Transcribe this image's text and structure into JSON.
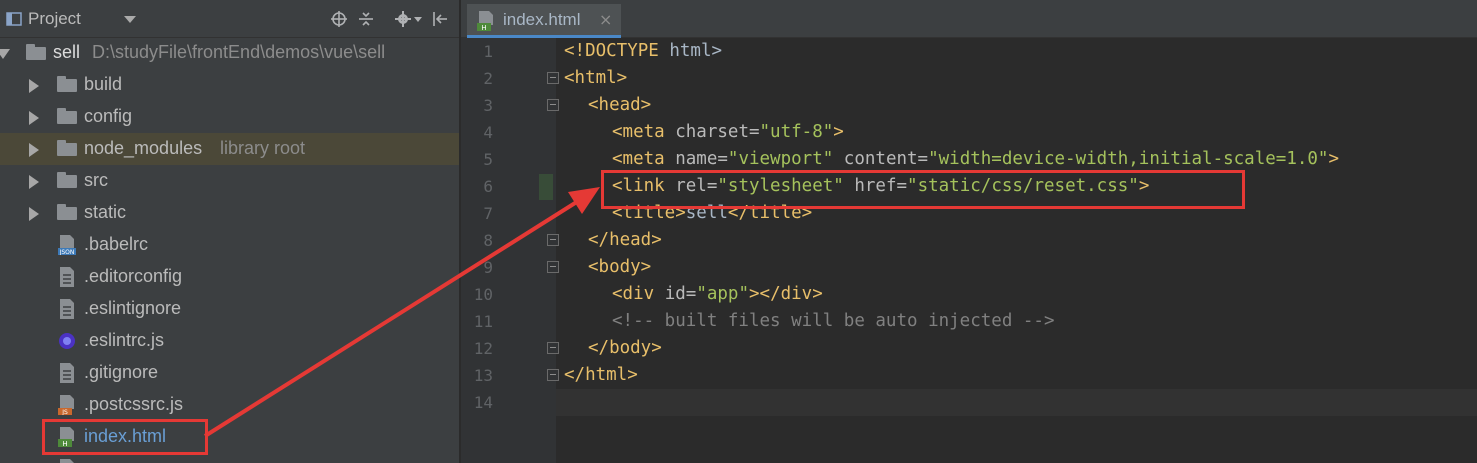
{
  "project_panel": {
    "title": "Project",
    "tree": [
      {
        "label": "sell",
        "path": "D:\\studyFile\\frontEnd\\demos\\vue\\sell",
        "type": "folder",
        "expanded": true
      },
      {
        "label": "build",
        "type": "folder"
      },
      {
        "label": "config",
        "type": "folder"
      },
      {
        "label": "node_modules",
        "sublabel": "library root",
        "type": "folder"
      },
      {
        "label": "src",
        "type": "folder"
      },
      {
        "label": "static",
        "type": "folder"
      },
      {
        "label": ".babelrc",
        "type": "file",
        "icon": "json-file-icon"
      },
      {
        "label": ".editorconfig",
        "type": "file",
        "icon": "text-file-icon"
      },
      {
        "label": ".eslintignore",
        "type": "file",
        "icon": "text-file-icon"
      },
      {
        "label": ".eslintrc.js",
        "type": "file",
        "icon": "eslint-icon"
      },
      {
        "label": ".gitignore",
        "type": "file",
        "icon": "text-file-icon"
      },
      {
        "label": ".postcssrc.js",
        "type": "file",
        "icon": "js-file-icon"
      },
      {
        "label": "index.html",
        "type": "file",
        "icon": "html-file-icon"
      }
    ]
  },
  "editor": {
    "tab": {
      "label": "index.html",
      "close": "×"
    },
    "line_numbers": [
      "1",
      "2",
      "3",
      "4",
      "5",
      "6",
      "7",
      "8",
      "9",
      "10",
      "11",
      "12",
      "13",
      "14"
    ],
    "code": {
      "l1": {
        "a": "<!DOCTYPE",
        "b": " html>"
      },
      "l2": {
        "a": "<html>"
      },
      "l3": {
        "a": "<head>"
      },
      "l4": {
        "a": "<meta",
        "b": " charset=",
        "c": "\"utf-8\"",
        "d": ">"
      },
      "l5": {
        "a": "<meta",
        "b": " name=",
        "c": "\"viewport\"",
        "d": " content=",
        "e": "\"width=device-width,initial-scale=1.0\"",
        "f": ">"
      },
      "l6": {
        "a": "<link",
        "b": " rel=",
        "c": "\"stylesheet\"",
        "d": " href=",
        "e": "\"static/css/reset.css\"",
        "f": ">"
      },
      "l7": {
        "a": "<title>",
        "b": "sell",
        "c": "</title>"
      },
      "l8": {
        "a": "</head>"
      },
      "l9": {
        "a": "<body>"
      },
      "l10": {
        "a": "<div",
        "b": " id=",
        "c": "\"app\"",
        "d": "></div>"
      },
      "l11": {
        "a": "<!-- built files will be auto injected -->"
      },
      "l12": {
        "a": "</body>"
      },
      "l13": {
        "a": "</html>"
      }
    }
  },
  "colors": {
    "annotation": "#e53935",
    "tag": "#e8bf6a",
    "string": "#a5c25c"
  }
}
